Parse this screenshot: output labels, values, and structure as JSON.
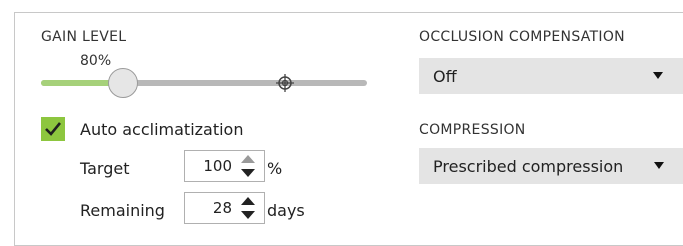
{
  "gain": {
    "label": "GAIN LEVEL",
    "value_text": "80%",
    "value_fraction": 0.25,
    "colors": {
      "fill": "#a6d17a",
      "track": "#b8b8b8"
    }
  },
  "auto_acclimatization": {
    "label": "Auto acclimatization",
    "checked": true,
    "checkbox_color": "#8dc63f",
    "target": {
      "label": "Target",
      "value": "100",
      "unit": "%"
    },
    "remaining": {
      "label": "Remaining",
      "value": "28",
      "unit": "days"
    }
  },
  "occlusion": {
    "label": "OCCLUSION COMPENSATION",
    "selected": "Off"
  },
  "compression": {
    "label": "COMPRESSION",
    "selected": "Prescribed compression"
  },
  "icons": {
    "slider_target": "crosshair-icon",
    "check": "checkmark-icon",
    "stepper_up": "triangle-up-icon",
    "stepper_down": "triangle-down-icon",
    "dropdown": "caret-down-icon"
  }
}
